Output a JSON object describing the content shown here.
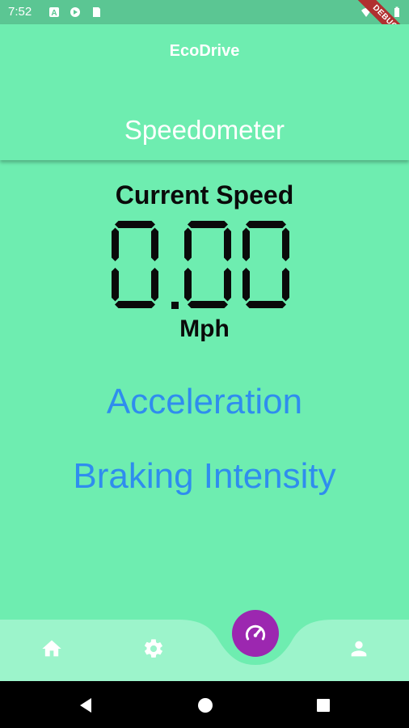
{
  "status_bar": {
    "time": "7:52",
    "debug_label": "DEBUG"
  },
  "header": {
    "app_title": "EcoDrive",
    "screen_title": "Speedometer"
  },
  "speedometer": {
    "label": "Current Speed",
    "value": "0.00",
    "unit": "Mph"
  },
  "links": {
    "acceleration": "Acceleration",
    "braking": "Braking Intensity"
  },
  "bottom_nav": {
    "items": [
      {
        "icon": "home-icon"
      },
      {
        "icon": "gear-icon"
      },
      {
        "icon": "speedometer-icon",
        "active": true
      },
      {
        "icon": "person-icon"
      }
    ]
  },
  "colors": {
    "background": "#6EEDB0",
    "status_bar": "#5BC693",
    "accent": "#9C27B0",
    "link": "#2F8DEE",
    "nav_bar": "#9CF4CB"
  }
}
